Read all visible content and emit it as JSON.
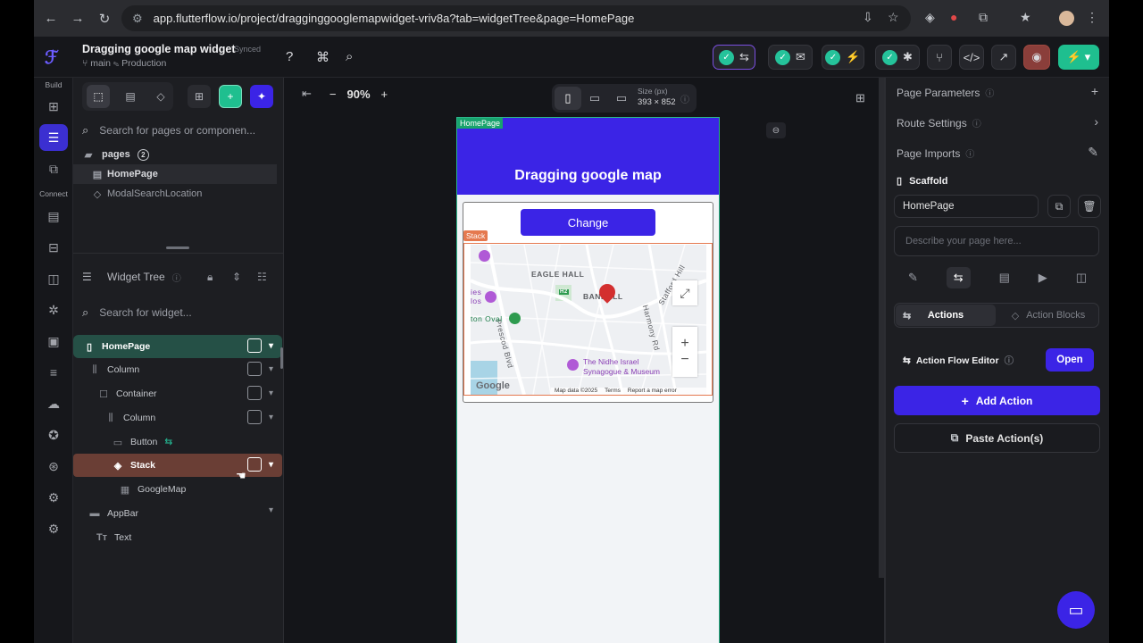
{
  "browser": {
    "url": "app.flutterflow.io/project/dragginggooglemapwidget-vriv8a?tab=widgetTree&page=HomePage",
    "back": "←",
    "forward": "→",
    "reload": "↻"
  },
  "header": {
    "project_title": "Dragging google map widget",
    "sync_status": "Synced",
    "branch": "main",
    "environment": "Production",
    "help": "?",
    "cmd": "⌘",
    "search": "⌕"
  },
  "rail": {
    "build_label": "Build",
    "connect_label": "Connect"
  },
  "left_panel": {
    "search_pages_placeholder": "Search for pages or componen...",
    "pages_label": "pages",
    "pages_count": "2",
    "pages": [
      "HomePage",
      "ModalSearchLocation"
    ],
    "widget_tree_label": "Widget Tree",
    "search_widget_placeholder": "Search for widget...",
    "tree": [
      {
        "label": "HomePage"
      },
      {
        "label": "Column"
      },
      {
        "label": "Container"
      },
      {
        "label": "Column"
      },
      {
        "label": "Button"
      },
      {
        "label": "Stack"
      },
      {
        "label": "GoogleMap"
      },
      {
        "label": "AppBar"
      },
      {
        "label": "Text"
      }
    ]
  },
  "canvas": {
    "zoom": "90%",
    "size_label": "Size (px)",
    "size_value": "393 × 852",
    "page_tag": "HomePage",
    "appbar_title": "Dragging google map",
    "button_label": "Change",
    "stack_tag": "Stack",
    "map": {
      "labels": [
        "EAGLE HALL",
        "BANDALL",
        "Stafford Hill",
        "Harmony Rd",
        "Prescod Blvd",
        "ton Oval",
        "The Nidhe Israel",
        "Synagogue & Museum",
        "ies",
        "los",
        "H2"
      ],
      "attribution": "Map data ©2025",
      "terms": "Terms",
      "report": "Report a map error",
      "logo": "Google"
    }
  },
  "right_panel": {
    "page_parameters": "Page Parameters",
    "route_settings": "Route Settings",
    "page_imports": "Page Imports",
    "scaffold": "Scaffold",
    "page_name": "HomePage",
    "describe_placeholder": "Describe your page here...",
    "tab_actions": "Actions",
    "tab_action_blocks": "Action Blocks",
    "action_flow_editor": "Action Flow Editor",
    "open_button": "Open",
    "add_action": "Add Action",
    "paste_actions": "Paste Action(s)"
  },
  "colors": {
    "primary": "#3b24e6",
    "accent_green": "#25c39b",
    "stack_orange": "#e5794f"
  }
}
